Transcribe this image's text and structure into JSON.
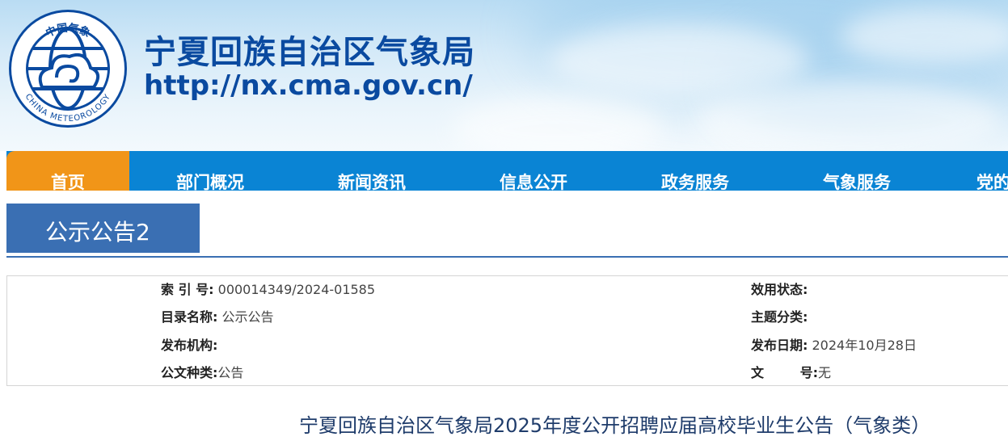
{
  "site": {
    "title": "宁夏回族自治区气象局",
    "url": "http://nx.cma.gov.cn/",
    "logo_ring_top": "中国气象",
    "logo_ring_bottom": "CHINA METEOROLOGY"
  },
  "nav": {
    "items": [
      {
        "label": "首页",
        "active": true
      },
      {
        "label": "部门概况"
      },
      {
        "label": "新闻资讯"
      },
      {
        "label": "信息公开"
      },
      {
        "label": "政务服务"
      },
      {
        "label": "气象服务"
      },
      {
        "label": "党的"
      }
    ]
  },
  "section": {
    "title": "公示公告2"
  },
  "meta": {
    "index_label": "索 引 号:",
    "index_value": "000014349/2024-01585",
    "catalog_label": "目录名称:",
    "catalog_value": "公示公告",
    "publisher_label": "发布机构:",
    "publisher_value": "",
    "doctype_label": "公文种类:",
    "doctype_value": "公告",
    "status_label": "效用状态:",
    "status_value": "",
    "topic_label": "主题分类:",
    "topic_value": "",
    "date_label": "发布日期:",
    "date_value": "2024年10月28日",
    "docno_label": "文        号:",
    "docno_value": "无"
  },
  "article": {
    "title": "宁夏回族自治区气象局2025年度公开招聘应届高校毕业生公告（气象类）"
  },
  "colors": {
    "brand_blue": "#0a4aa0",
    "nav_blue": "#0a84d4",
    "nav_active_orange": "#f19518",
    "section_blue": "#3a6fb3"
  }
}
